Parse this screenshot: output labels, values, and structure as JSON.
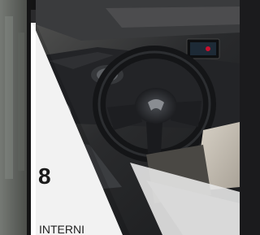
{
  "slide": {
    "number": "8",
    "caption": "INTERNI"
  },
  "photo": {
    "subject": "car-interior-dashboard-steering-wheel",
    "panel_color": "#f2f2f2",
    "accent_color": "#c8102e"
  }
}
